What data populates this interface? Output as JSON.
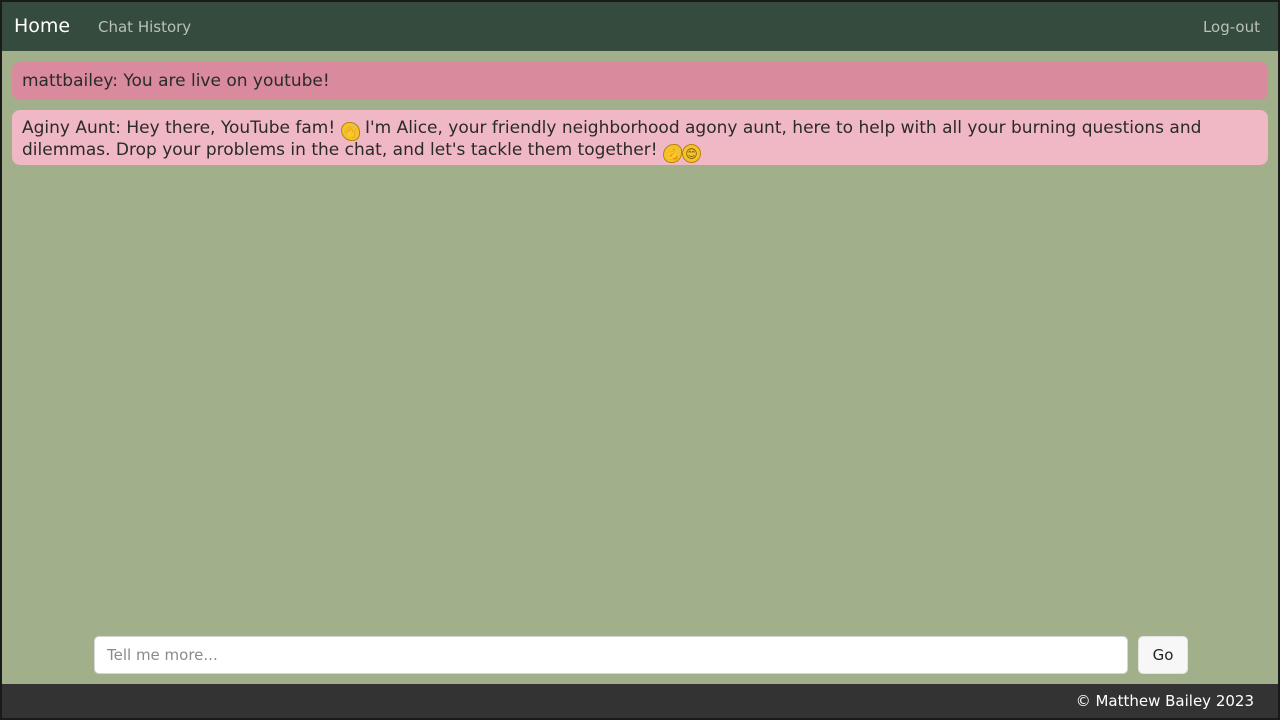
{
  "nav": {
    "brand": "Home",
    "links": [
      {
        "label": "Chat History"
      },
      {
        "label": "Log-out"
      }
    ]
  },
  "messages": [
    {
      "text": "mattbailey: You are live on youtube!"
    },
    {
      "part1": "Aginy Aunt: Hey there, YouTube fam! ",
      "emoji1": "👋",
      "part2": " I'm Alice, your friendly neighborhood agony aunt, here to help with all your burning questions and dilemmas. Drop your problems in the chat, and let's tackle them together! ",
      "emoji2": "💪",
      "emoji3": "😊"
    }
  ],
  "input": {
    "placeholder": "Tell me more...",
    "value": ""
  },
  "button": {
    "label": "Go"
  },
  "footer": {
    "text": "© Matthew Bailey 2023"
  },
  "colors": {
    "navbar": "#344b3d",
    "background": "#a1b08b",
    "user_message": "#d98a9c",
    "bot_message": "#f0b8c4",
    "footer": "#333333"
  }
}
